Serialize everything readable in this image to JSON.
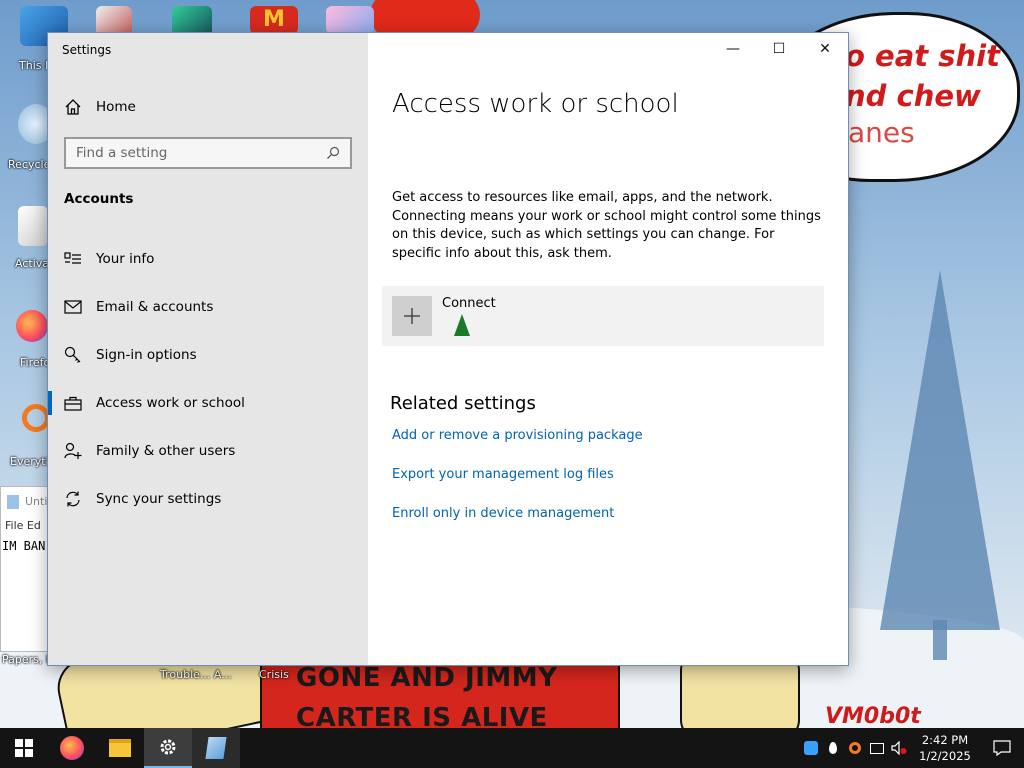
{
  "desktop": {
    "icons": [
      {
        "label": "This P",
        "icon": "this-pc-icon"
      },
      {
        "label": "Recycle",
        "icon": "recycle-bin-icon"
      },
      {
        "label": "Activa",
        "icon": "activate-icon"
      },
      {
        "label": "Firefo",
        "icon": "firefox-icon"
      },
      {
        "label": "Everyth",
        "icon": "everything-icon"
      },
      {
        "label": "Papers, P",
        "icon": "papers-icon"
      },
      {
        "label": "Trouble... A...",
        "icon": "trouble-icon"
      },
      {
        "label": "Crisis",
        "icon": "crisis-icon"
      }
    ],
    "wallpaper_text": {
      "bubble_line1": "o eat shit",
      "bubble_line2": "nd chew",
      "bubble_line3": "anes",
      "caption_line1": "GONE AND JIMMY",
      "caption_line2": "CARTER IS ALIVE",
      "signature": "VM0b0t"
    },
    "notepad": {
      "title": "Unti",
      "menu": "File   Ed",
      "text": "IM BAN"
    }
  },
  "window": {
    "title": "Settings",
    "controls": {
      "minimize": "—",
      "maximize": "☐",
      "close": "✕"
    }
  },
  "sidebar": {
    "home_label": "Home",
    "search_placeholder": "Find a setting",
    "section_title": "Accounts",
    "items": [
      {
        "label": "Your info",
        "icon": "person-card-icon",
        "selected": false
      },
      {
        "label": "Email & accounts",
        "icon": "envelope-icon",
        "selected": false
      },
      {
        "label": "Sign-in options",
        "icon": "key-icon",
        "selected": false
      },
      {
        "label": "Access work or school",
        "icon": "briefcase-icon",
        "selected": true
      },
      {
        "label": "Family & other users",
        "icon": "person-add-icon",
        "selected": false
      },
      {
        "label": "Sync your settings",
        "icon": "sync-icon",
        "selected": false
      }
    ]
  },
  "main": {
    "title": "Access work or school",
    "description": "Get access to resources like email, apps, and the network. Connecting means your work or school might control some things on this device, such as which settings you can change. For specific info about this, ask them.",
    "connect_label": "Connect",
    "related_title": "Related settings",
    "related_links": [
      "Add or remove a provisioning package",
      "Export your management log files",
      "Enroll only in device management"
    ]
  },
  "taskbar": {
    "apps": [
      "start-icon",
      "firefox-icon",
      "file-explorer-icon",
      "settings-icon",
      "notepad-icon"
    ],
    "active_app": "settings-icon",
    "clock_time": "2:42 PM",
    "clock_date": "1/2/2025"
  }
}
